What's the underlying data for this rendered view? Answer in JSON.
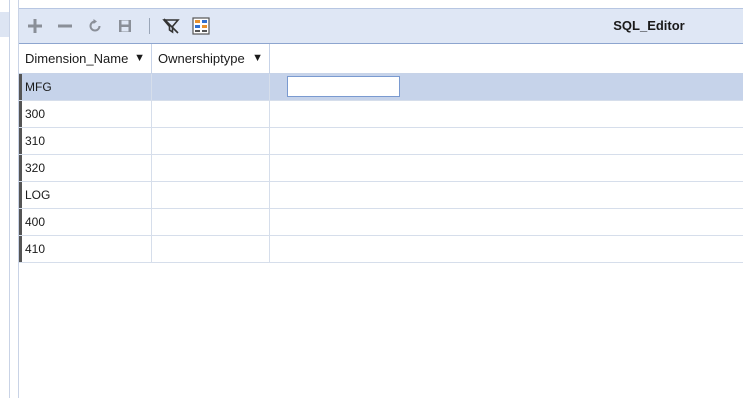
{
  "toolbar": {
    "title": "SQL_Editor",
    "buttons": [
      {
        "name": "add-row-button",
        "icon": "plus-icon"
      },
      {
        "name": "remove-row-button",
        "icon": "minus-icon"
      },
      {
        "name": "refresh-button",
        "icon": "refresh-icon"
      },
      {
        "name": "save-button",
        "icon": "save-icon"
      },
      {
        "name": "clear-filter-button",
        "icon": "filter-off-icon"
      },
      {
        "name": "export-button",
        "icon": "grid-export-icon"
      }
    ]
  },
  "grid": {
    "columns": [
      "Dimension_Name",
      "Ownershiptype"
    ],
    "rows": [
      {
        "dimension_name": "MFG",
        "ownershiptype": ""
      },
      {
        "dimension_name": "300",
        "ownershiptype": ""
      },
      {
        "dimension_name": "310",
        "ownershiptype": ""
      },
      {
        "dimension_name": "320",
        "ownershiptype": ""
      },
      {
        "dimension_name": "LOG",
        "ownershiptype": ""
      },
      {
        "dimension_name": "400",
        "ownershiptype": ""
      },
      {
        "dimension_name": "410",
        "ownershiptype": ""
      }
    ]
  },
  "colors": {
    "toolbar_bg": "#dfe7f5",
    "selected_row": "#c6d3ea",
    "icon_gray": "#8a8f98",
    "accent_blue": "#2f6fd0",
    "accent_orange": "#e8912d"
  }
}
